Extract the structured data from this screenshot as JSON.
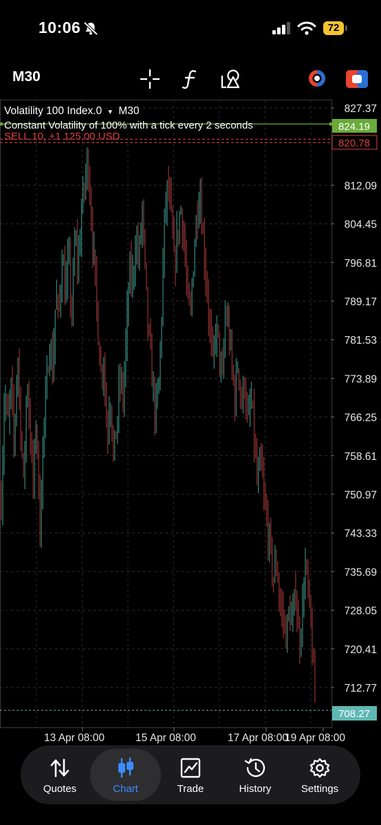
{
  "status_bar": {
    "time": "10:06",
    "battery": "72"
  },
  "toolbar": {
    "timeframe": "M30",
    "icons": [
      "crosshair-icon",
      "function-icon",
      "objects-icon",
      "color-theme-icon",
      "trade-toggle-icon"
    ]
  },
  "chart": {
    "symbol_label": "Volatility 100 Index.0",
    "dropdown_glyph": "▾",
    "timeframe_label": "M30",
    "description": "Constant Volatility of 100% with a tick every 2 seconds",
    "position_label": "SELL 10, +1 125.00 USD",
    "colors": {
      "bull": "#2f7f73",
      "bear": "#8a2e2e",
      "bid_line": "#6aaa3a",
      "sell_line": "#d84040",
      "ask_line": "#5fb8b3",
      "accent_blue": "#3b8cff"
    }
  },
  "chart_data": {
    "type": "candlestick",
    "y_ticks": [
      "827.37",
      "812.09",
      "804.45",
      "796.81",
      "789.17",
      "781.53",
      "773.89",
      "766.25",
      "758.61",
      "750.97",
      "743.33",
      "735.69",
      "728.05",
      "720.41",
      "712.77"
    ],
    "x_ticks": [
      "13 Apr 08:00",
      "15 Apr 08:00",
      "17 Apr 08:00",
      "19 Apr 08:00"
    ],
    "price_labels": {
      "bid": "824.19",
      "sell": "820.78",
      "current": "708.27"
    },
    "ylim": [
      705.0,
      829.0
    ],
    "close_path": [
      750,
      772,
      764,
      772,
      760,
      780,
      765,
      752,
      775,
      763,
      752,
      768,
      742,
      762,
      770,
      782,
      775,
      790,
      786,
      799,
      790,
      798,
      786,
      802,
      796,
      807,
      812,
      818,
      807,
      796,
      786,
      775,
      778,
      762,
      772,
      758,
      764,
      774,
      770,
      782,
      795,
      793,
      802,
      797,
      808,
      793,
      782,
      775,
      767,
      770,
      785,
      806,
      812,
      806,
      796,
      802,
      808,
      802,
      791,
      785,
      797,
      806,
      812,
      802,
      794,
      785,
      776,
      784,
      780,
      772,
      787,
      784,
      776,
      770,
      778,
      768,
      774,
      764,
      770,
      762,
      752,
      758,
      750,
      745,
      740,
      734,
      738,
      729,
      727,
      723,
      728,
      725,
      733,
      721,
      728,
      737,
      730,
      722,
      710
    ]
  },
  "tabs": [
    {
      "label": "Quotes",
      "icon": "quotes-arrows-icon"
    },
    {
      "label": "Chart",
      "icon": "candlestick-icon"
    },
    {
      "label": "Trade",
      "icon": "trade-chart-icon"
    },
    {
      "label": "History",
      "icon": "history-clock-icon"
    },
    {
      "label": "Settings",
      "icon": "gear-icon"
    }
  ]
}
